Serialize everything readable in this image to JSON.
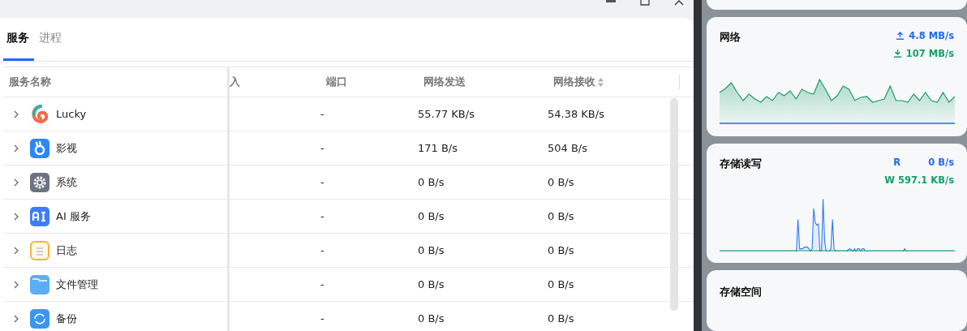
{
  "window": {
    "tabs": [
      {
        "label": "服务",
        "selected": true
      },
      {
        "label": "进程",
        "selected": false
      }
    ]
  },
  "table": {
    "columns": [
      {
        "label": "服务名称",
        "sortable": false
      },
      {
        "label": "入",
        "sortable": false
      },
      {
        "label": "端口",
        "sortable": false
      },
      {
        "label": "网络发送",
        "sortable": false
      },
      {
        "label": "网络接收",
        "sortable": true
      }
    ],
    "rows": [
      {
        "kind": "swirl",
        "name": "Lucky",
        "port": "-",
        "send": "55.77 KB/s",
        "receive": "54.38 KB/s"
      },
      {
        "kind": "film",
        "name": "影视",
        "port": "-",
        "send": "171 B/s",
        "receive": "504 B/s"
      },
      {
        "kind": "gear",
        "name": "系统",
        "port": "-",
        "send": "0 B/s",
        "receive": "0 B/s"
      },
      {
        "kind": "ai",
        "name": "AI 服务",
        "port": "-",
        "send": "0 B/s",
        "receive": "0 B/s"
      },
      {
        "kind": "notes",
        "name": "日志",
        "port": "-",
        "send": "0 B/s",
        "receive": "0 B/s"
      },
      {
        "kind": "folder",
        "name": "文件管理",
        "port": "-",
        "send": "0 B/s",
        "receive": "0 B/s"
      },
      {
        "kind": "sync",
        "name": "备份",
        "port": "-",
        "send": "0 B/s",
        "receive": "0 B/s"
      }
    ]
  },
  "widgets": {
    "network": {
      "title": "网络",
      "upload": "4.8 MB/s",
      "download": "107 MB/s"
    },
    "storage_io": {
      "title": "存储读写",
      "read_label": "R",
      "read": "0 B/s",
      "write": "W 597.1 KB/s"
    },
    "storage_space": {
      "title": "存储空间"
    }
  }
}
